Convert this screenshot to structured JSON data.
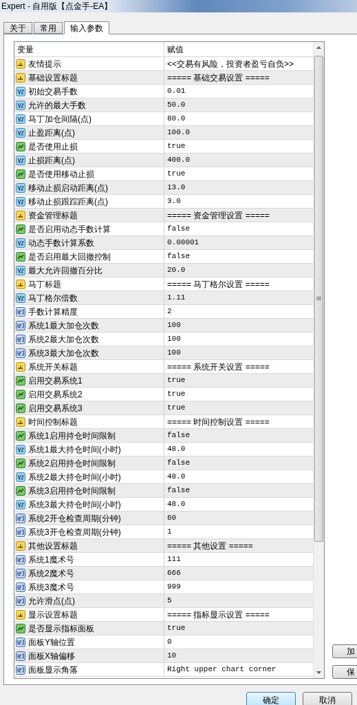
{
  "window": {
    "title": "Expert - 自用版【点金手-EA】"
  },
  "tabs": [
    {
      "label": "关于",
      "selected": false
    },
    {
      "label": "常用",
      "selected": false
    },
    {
      "label": "输入参数",
      "selected": true
    }
  ],
  "table": {
    "columns": [
      "变量",
      "赋值"
    ],
    "rows": [
      {
        "kind": "string",
        "name": "友情提示",
        "value": "<<交易有风险，投资者盈亏自负>>"
      },
      {
        "kind": "string",
        "name": "基础设置标题",
        "value": "===== 基础交易设置 ====="
      },
      {
        "kind": "double",
        "name": "初始交易手数",
        "value": "0.01"
      },
      {
        "kind": "double",
        "name": "允许的最大手数",
        "value": "50.0"
      },
      {
        "kind": "double",
        "name": "马丁加仓间隔(点)",
        "value": "80.0"
      },
      {
        "kind": "double",
        "name": "止盈距离(点)",
        "value": "100.0"
      },
      {
        "kind": "bool",
        "name": "是否使用止损",
        "value": "true"
      },
      {
        "kind": "double",
        "name": "止损距离(点)",
        "value": "400.0"
      },
      {
        "kind": "bool",
        "name": "是否使用移动止损",
        "value": "true"
      },
      {
        "kind": "double",
        "name": "移动止损启动距离(点)",
        "value": "13.0"
      },
      {
        "kind": "double",
        "name": "移动止损跟踪距离(点)",
        "value": "3.0"
      },
      {
        "kind": "string",
        "name": "资金管理标题",
        "value": "===== 资金管理设置 ====="
      },
      {
        "kind": "bool",
        "name": "是否启用动态手数计算",
        "value": "false"
      },
      {
        "kind": "double",
        "name": "动态手数计算系数",
        "value": "0.00001"
      },
      {
        "kind": "bool",
        "name": "是否启用最大回撤控制",
        "value": "false"
      },
      {
        "kind": "double",
        "name": "最大允许回撤百分比",
        "value": "20.0"
      },
      {
        "kind": "string",
        "name": "马丁标题",
        "value": "===== 马丁格尔设置 ====="
      },
      {
        "kind": "double",
        "name": "马丁格尔倍数",
        "value": "1.11"
      },
      {
        "kind": "int",
        "name": "手数计算精度",
        "value": "2"
      },
      {
        "kind": "int",
        "name": "系统1最大加仓次数",
        "value": "100"
      },
      {
        "kind": "int",
        "name": "系统2最大加仓次数",
        "value": "100"
      },
      {
        "kind": "int",
        "name": "系统3最大加仓次数",
        "value": "100"
      },
      {
        "kind": "string",
        "name": "系统开关标题",
        "value": "===== 系统开关设置 ====="
      },
      {
        "kind": "bool",
        "name": "启用交易系统1",
        "value": "true"
      },
      {
        "kind": "bool",
        "name": "启用交易系统2",
        "value": "true"
      },
      {
        "kind": "bool",
        "name": "启用交易系统3",
        "value": "true"
      },
      {
        "kind": "string",
        "name": "时间控制标题",
        "value": "===== 时间控制设置 ====="
      },
      {
        "kind": "bool",
        "name": "系统1启用持仓时间限制",
        "value": "false"
      },
      {
        "kind": "double",
        "name": "系统1最大持仓时间(小时)",
        "value": "48.0"
      },
      {
        "kind": "bool",
        "name": "系统2启用持仓时间限制",
        "value": "false"
      },
      {
        "kind": "double",
        "name": "系统2最大持仓时间(小时)",
        "value": "48.0"
      },
      {
        "kind": "bool",
        "name": "系统3启用持仓时间限制",
        "value": "false"
      },
      {
        "kind": "double",
        "name": "系统3最大持仓时间(小时)",
        "value": "48.0"
      },
      {
        "kind": "int",
        "name": "系统2开仓检查周期(分钟)",
        "value": "60"
      },
      {
        "kind": "int",
        "name": "系统3开仓检查周期(分钟)",
        "value": "1"
      },
      {
        "kind": "string",
        "name": "其他设置标题",
        "value": "===== 其他设置 ====="
      },
      {
        "kind": "int",
        "name": "系统1魔术号",
        "value": "111"
      },
      {
        "kind": "int",
        "name": "系统2魔术号",
        "value": "666"
      },
      {
        "kind": "int",
        "name": "系统3魔术号",
        "value": "999"
      },
      {
        "kind": "int",
        "name": "允许滑点(点)",
        "value": "5"
      },
      {
        "kind": "string",
        "name": "显示设置标题",
        "value": "===== 指标显示设置 ====="
      },
      {
        "kind": "bool",
        "name": "是否显示指标面板",
        "value": "true"
      },
      {
        "kind": "int",
        "name": "面板Y轴位置",
        "value": "0"
      },
      {
        "kind": "int",
        "name": "面板X轴偏移",
        "value": "10"
      },
      {
        "kind": "int",
        "name": "面板显示角落",
        "value": "Right upper chart corner"
      }
    ]
  },
  "side_buttons": [
    "加",
    "保"
  ],
  "buttons": [
    {
      "label": "确定",
      "default": true
    },
    {
      "label": "取消",
      "default": false
    }
  ]
}
